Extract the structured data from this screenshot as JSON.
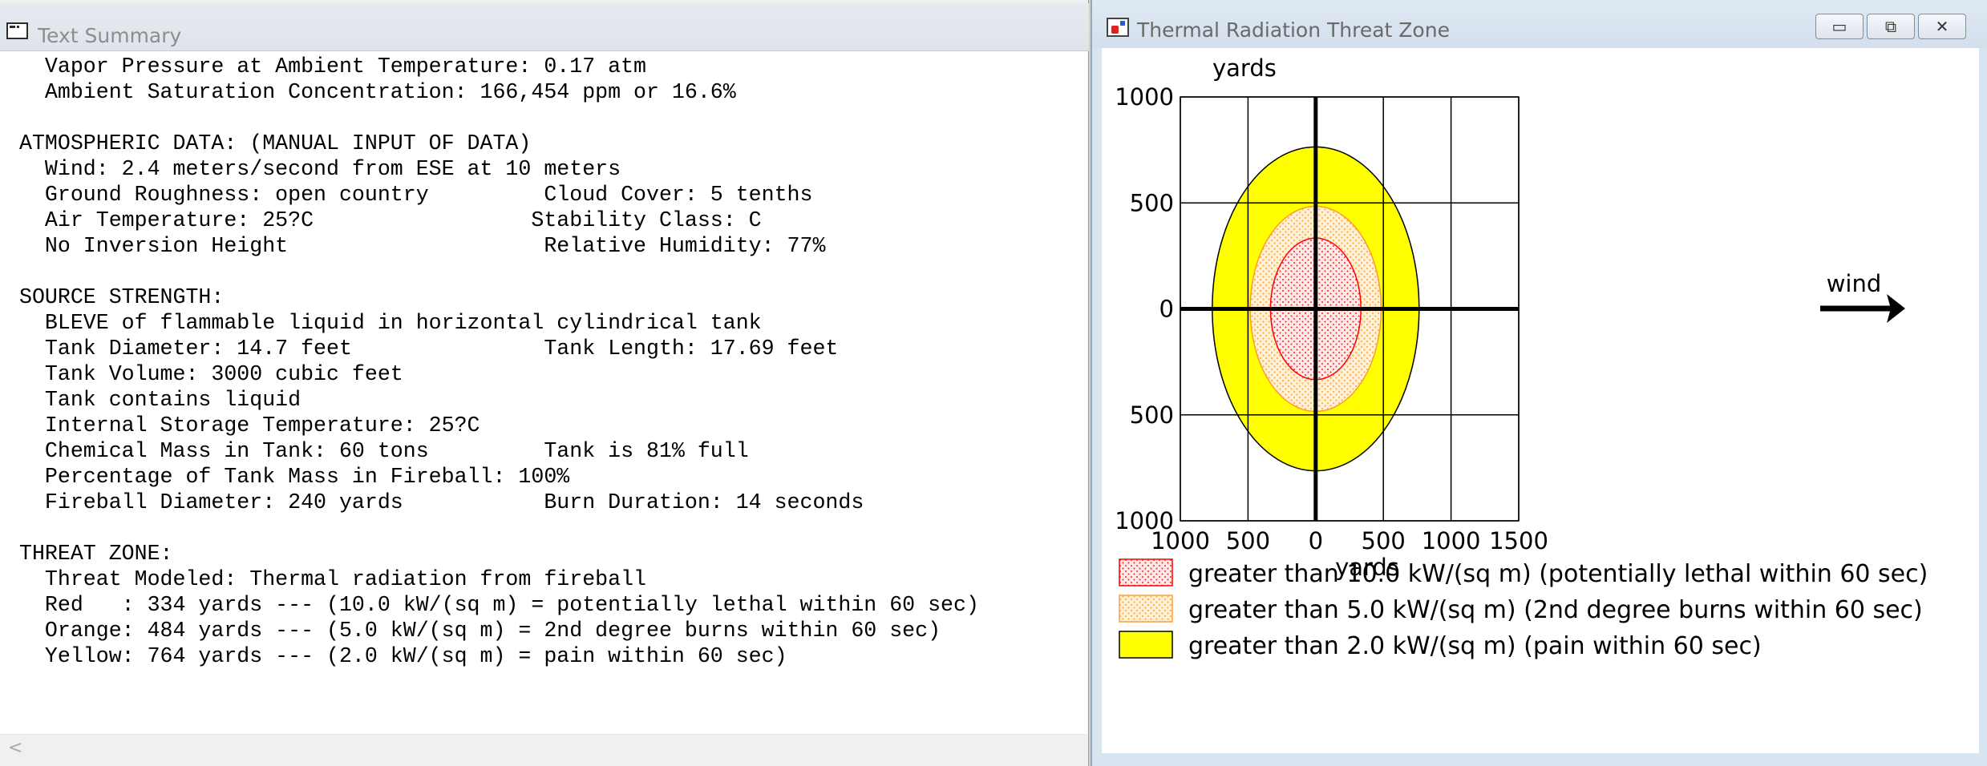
{
  "text_summary": {
    "window_title": "Text Summary",
    "lines": [
      "  Vapor Pressure at Ambient Temperature: 0.17 atm",
      "  Ambient Saturation Concentration: 166,454 ppm or 16.6%",
      "",
      "ATMOSPHERIC DATA: (MANUAL INPUT OF DATA)",
      "  Wind: 2.4 meters/second from ESE at 10 meters",
      "  Ground Roughness: open country         Cloud Cover: 5 tenths",
      "  Air Temperature: 25?C                 Stability Class: C",
      "  No Inversion Height                    Relative Humidity: 77%",
      "",
      "SOURCE STRENGTH:",
      "  BLEVE of flammable liquid in horizontal cylindrical tank",
      "  Tank Diameter: 14.7 feet               Tank Length: 17.69 feet",
      "  Tank Volume: 3000 cubic feet",
      "  Tank contains liquid",
      "  Internal Storage Temperature: 25?C",
      "  Chemical Mass in Tank: 60 tons         Tank is 81% full",
      "  Percentage of Tank Mass in Fireball: 100%",
      "  Fireball Diameter: 240 yards           Burn Duration: 14 seconds",
      "",
      "THREAT ZONE:",
      "  Threat Modeled: Thermal radiation from fireball",
      "  Red   : 334 yards --- (10.0 kW/(sq m) = potentially lethal within 60 sec)",
      "  Orange: 484 yards --- (5.0 kW/(sq m) = 2nd degree burns within 60 sec)",
      "  Yellow: 764 yards --- (2.0 kW/(sq m) = pain within 60 sec)"
    ],
    "scroll_left_glyph": "<"
  },
  "threat_zone": {
    "window_title": "Thermal Radiation Threat Zone",
    "buttons": {
      "minimize": "▭",
      "maximize": "⧉",
      "close": "✕"
    },
    "wind_label": "wind",
    "legend": [
      {
        "label": "greater than 10.0 kW/(sq m) (potentially lethal within 60 sec)",
        "color": "#ff0000",
        "pattern": "dots-red"
      },
      {
        "label": "greater than 5.0 kW/(sq m) (2nd degree burns within 60 sec)",
        "color": "#ffa500",
        "pattern": "dots-orange"
      },
      {
        "label": "greater than 2.0 kW/(sq m) (pain within 60 sec)",
        "color": "#ffff00",
        "pattern": "solid-yellow"
      }
    ]
  },
  "chart_data": {
    "type": "area",
    "title": "",
    "xlabel": "yards",
    "ylabel": "yards",
    "xlim": [
      -1000,
      1500
    ],
    "ylim": [
      -1000,
      1000
    ],
    "x_ticks": [
      -1000,
      -500,
      0,
      500,
      1000,
      1500
    ],
    "x_tick_labels": [
      "1000",
      "500",
      "0",
      "500",
      "1000",
      "1500"
    ],
    "y_ticks": [
      1000,
      500,
      0,
      -500,
      -1000
    ],
    "y_tick_labels": [
      "1000",
      "500",
      "0",
      "500",
      "1000"
    ],
    "grid": true,
    "zones": [
      {
        "name": "Yellow",
        "radius_yards": 764,
        "color": "#ffff00"
      },
      {
        "name": "Orange",
        "radius_yards": 484,
        "color": "#ffa500"
      },
      {
        "name": "Red",
        "radius_yards": 334,
        "color": "#ff0000"
      }
    ],
    "wind_direction": "east"
  }
}
